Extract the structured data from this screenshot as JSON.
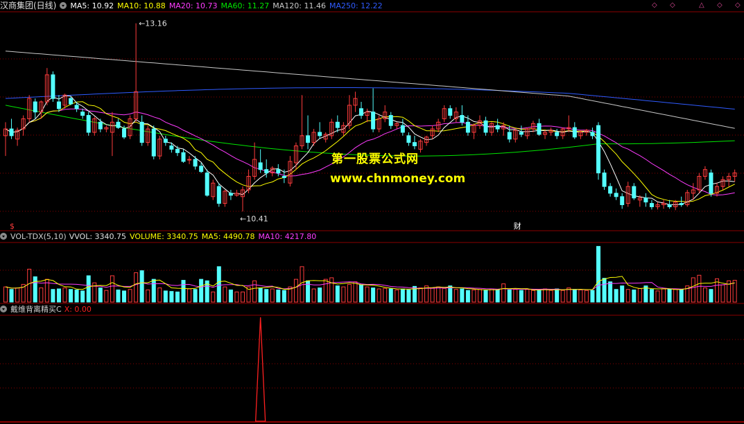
{
  "price_panel": {
    "title": "汉商集团(日线)",
    "ma": [
      {
        "label": "MA5: 10.92",
        "color": "#ffffff"
      },
      {
        "label": "MA10: 10.88",
        "color": "#ffff00"
      },
      {
        "label": "MA20: 10.73",
        "color": "#ff3cff"
      },
      {
        "label": "MA60: 11.27",
        "color": "#00e600"
      },
      {
        "label": "MA120: 11.46",
        "color": "#c8c8c8"
      },
      {
        "label": "MA250: 12.22",
        "color": "#2f5bff"
      }
    ],
    "high_label": "13.16",
    "low_label": "10.41",
    "marker_left": "$",
    "marker_fin": "财",
    "nav_icons": [
      "◇",
      "◇",
      "△",
      "◇",
      "◇"
    ]
  },
  "volume_panel": {
    "title": "VOL-TDX(5,10)",
    "vvol": "VVOL: 3340.75",
    "volume": "VOLUME: 3340.75",
    "ma5": "MA5: 4490.78",
    "ma10": "MA10: 4217.80"
  },
  "indicator_panel": {
    "title": "戴维背离精买C",
    "x_value": "X: 0.00"
  },
  "watermark": {
    "line1": "第一股票公式网",
    "line2": "www.chnmoney.com"
  },
  "colors": {
    "up": "#ff3c3c",
    "down": "#54ffff",
    "grid": "#8b0000",
    "ma5": "#ffffff",
    "ma10": "#ffff00",
    "ma20": "#ff3cff",
    "ma60": "#00e600",
    "ma120": "#c8c8c8",
    "ma250": "#2f5bff",
    "indicator": "#ff2020"
  },
  "chart_data": {
    "type": "candlestick",
    "price_axis_range": [
      10.25,
      13.3
    ],
    "candles_ohlc": [
      [
        11.5,
        11.7,
        11.2,
        11.6
      ],
      [
        11.6,
        11.75,
        11.45,
        11.5
      ],
      [
        11.45,
        11.62,
        11.35,
        11.58
      ],
      [
        11.6,
        11.8,
        11.5,
        11.75
      ],
      [
        11.75,
        12.1,
        11.7,
        12.05
      ],
      [
        12.0,
        12.05,
        11.75,
        11.85
      ],
      [
        11.85,
        12.02,
        11.75,
        12.0
      ],
      [
        12.0,
        12.5,
        11.95,
        12.4
      ],
      [
        12.4,
        12.45,
        12.0,
        12.05
      ],
      [
        12.0,
        12.1,
        11.85,
        11.9
      ],
      [
        11.95,
        12.12,
        11.9,
        12.1
      ],
      [
        12.05,
        12.08,
        11.95,
        11.97
      ],
      [
        11.95,
        12.0,
        11.85,
        11.9
      ],
      [
        11.85,
        11.9,
        11.75,
        11.8
      ],
      [
        11.8,
        11.85,
        11.5,
        11.55
      ],
      [
        11.55,
        11.78,
        11.5,
        11.75
      ],
      [
        11.7,
        11.75,
        11.55,
        11.6
      ],
      [
        11.6,
        11.65,
        11.55,
        11.62
      ],
      [
        11.55,
        11.85,
        11.2,
        11.7
      ],
      [
        11.7,
        11.75,
        11.6,
        11.62
      ],
      [
        11.6,
        11.65,
        11.45,
        11.48
      ],
      [
        11.5,
        11.8,
        11.45,
        11.75
      ],
      [
        11.75,
        13.16,
        11.7,
        12.15
      ],
      [
        11.7,
        11.8,
        11.35,
        11.4
      ],
      [
        11.4,
        11.65,
        11.35,
        11.6
      ],
      [
        11.6,
        11.65,
        11.15,
        11.2
      ],
      [
        11.2,
        11.5,
        11.15,
        11.45
      ],
      [
        11.45,
        11.5,
        11.35,
        11.4
      ],
      [
        11.35,
        11.4,
        11.25,
        11.3
      ],
      [
        11.3,
        11.35,
        11.2,
        11.25
      ],
      [
        11.25,
        11.3,
        11.1,
        11.12
      ],
      [
        11.15,
        11.2,
        11.08,
        11.15
      ],
      [
        11.15,
        11.2,
        11.0,
        11.05
      ],
      [
        11.05,
        11.1,
        10.95,
        10.97
      ],
      [
        10.95,
        11.0,
        10.6,
        10.62
      ],
      [
        10.6,
        10.85,
        10.55,
        10.8
      ],
      [
        10.75,
        10.8,
        10.45,
        10.5
      ],
      [
        10.5,
        10.7,
        10.45,
        10.68
      ],
      [
        10.65,
        10.7,
        10.55,
        10.62
      ],
      [
        10.62,
        10.7,
        10.6,
        10.65
      ],
      [
        10.6,
        10.75,
        10.38,
        10.7
      ],
      [
        10.7,
        11.0,
        10.65,
        10.9
      ],
      [
        10.9,
        11.4,
        10.85,
        11.15
      ],
      [
        11.1,
        11.3,
        10.95,
        11.0
      ],
      [
        11.0,
        11.15,
        10.88,
        10.95
      ],
      [
        10.95,
        11.05,
        10.9,
        11.02
      ],
      [
        11.0,
        11.08,
        10.9,
        10.95
      ],
      [
        10.9,
        11.0,
        10.8,
        10.88
      ],
      [
        10.8,
        11.2,
        10.75,
        11.12
      ],
      [
        11.1,
        11.4,
        11.0,
        11.35
      ],
      [
        11.35,
        12.1,
        11.3,
        11.5
      ],
      [
        11.5,
        11.8,
        11.3,
        11.4
      ],
      [
        11.4,
        11.6,
        11.35,
        11.55
      ],
      [
        11.55,
        11.7,
        11.45,
        11.5
      ],
      [
        11.45,
        11.55,
        11.4,
        11.52
      ],
      [
        11.5,
        11.75,
        11.45,
        11.7
      ],
      [
        11.7,
        11.8,
        11.55,
        11.62
      ],
      [
        11.55,
        11.7,
        11.5,
        11.65
      ],
      [
        11.65,
        12.1,
        11.6,
        11.95
      ],
      [
        11.95,
        12.15,
        11.85,
        12.05
      ],
      [
        11.9,
        12.0,
        11.75,
        11.8
      ],
      [
        11.8,
        11.9,
        11.7,
        11.85
      ],
      [
        11.85,
        12.2,
        11.55,
        11.6
      ],
      [
        11.6,
        11.8,
        11.55,
        11.75
      ],
      [
        11.75,
        11.95,
        11.7,
        11.85
      ],
      [
        11.8,
        11.85,
        11.6,
        11.65
      ],
      [
        11.65,
        11.7,
        11.6,
        11.68
      ],
      [
        11.65,
        11.75,
        11.5,
        11.55
      ],
      [
        11.5,
        11.55,
        11.35,
        11.4
      ],
      [
        11.4,
        11.5,
        11.3,
        11.35
      ],
      [
        11.3,
        11.45,
        11.25,
        11.42
      ],
      [
        11.4,
        11.5,
        11.35,
        11.48
      ],
      [
        11.5,
        11.65,
        11.45,
        11.6
      ],
      [
        11.6,
        11.75,
        11.55,
        11.7
      ],
      [
        11.75,
        11.95,
        11.7,
        11.9
      ],
      [
        11.9,
        11.95,
        11.75,
        11.8
      ],
      [
        11.75,
        11.92,
        11.7,
        11.85
      ],
      [
        11.8,
        11.95,
        11.65,
        11.7
      ],
      [
        11.7,
        11.8,
        11.5,
        11.55
      ],
      [
        11.55,
        11.68,
        11.45,
        11.65
      ],
      [
        11.65,
        11.8,
        11.6,
        11.72
      ],
      [
        11.72,
        11.78,
        11.5,
        11.55
      ],
      [
        11.55,
        11.7,
        11.5,
        11.68
      ],
      [
        11.65,
        11.75,
        11.55,
        11.6
      ],
      [
        11.6,
        11.7,
        11.5,
        11.65
      ],
      [
        11.55,
        11.65,
        11.4,
        11.45
      ],
      [
        11.45,
        11.6,
        11.4,
        11.58
      ],
      [
        11.55,
        11.65,
        11.48,
        11.52
      ],
      [
        11.5,
        11.62,
        11.45,
        11.6
      ],
      [
        11.6,
        11.72,
        11.55,
        11.68
      ],
      [
        11.68,
        11.75,
        11.5,
        11.52
      ],
      [
        11.52,
        11.58,
        11.45,
        11.55
      ],
      [
        11.55,
        11.62,
        11.5,
        11.58
      ],
      [
        11.55,
        11.6,
        11.45,
        11.5
      ],
      [
        11.5,
        11.62,
        11.45,
        11.6
      ],
      [
        11.6,
        11.8,
        11.55,
        11.62
      ],
      [
        11.62,
        11.7,
        11.45,
        11.48
      ],
      [
        11.5,
        11.58,
        11.45,
        11.55
      ],
      [
        11.55,
        11.6,
        11.5,
        11.58
      ],
      [
        11.55,
        11.62,
        11.45,
        11.5
      ],
      [
        11.65,
        11.7,
        10.85,
        10.95
      ],
      [
        10.95,
        11.0,
        10.7,
        10.75
      ],
      [
        10.75,
        10.8,
        10.6,
        10.65
      ],
      [
        10.65,
        10.72,
        10.55,
        10.6
      ],
      [
        10.6,
        10.65,
        10.42,
        10.48
      ],
      [
        10.5,
        10.82,
        10.45,
        10.75
      ],
      [
        10.75,
        10.8,
        10.55,
        10.58
      ],
      [
        10.55,
        10.62,
        10.45,
        10.58
      ],
      [
        10.58,
        10.65,
        10.45,
        10.52
      ],
      [
        10.5,
        10.55,
        10.41,
        10.45
      ],
      [
        10.45,
        10.52,
        10.41,
        10.48
      ],
      [
        10.48,
        10.55,
        10.42,
        10.5
      ],
      [
        10.48,
        10.55,
        10.42,
        10.45
      ],
      [
        10.45,
        10.55,
        10.4,
        10.52
      ],
      [
        10.5,
        10.6,
        10.45,
        10.48
      ],
      [
        10.48,
        10.7,
        10.45,
        10.66
      ],
      [
        10.65,
        10.8,
        10.55,
        10.7
      ],
      [
        10.7,
        10.95,
        10.65,
        10.9
      ],
      [
        10.9,
        11.05,
        10.85,
        11.0
      ],
      [
        10.95,
        11.0,
        10.6,
        10.65
      ],
      [
        10.65,
        10.8,
        10.6,
        10.75
      ],
      [
        10.75,
        10.9,
        10.7,
        10.85
      ],
      [
        10.85,
        10.95,
        10.75,
        10.9
      ],
      [
        10.9,
        11.0,
        10.82,
        10.95
      ]
    ],
    "volumes": [
      3,
      2.5,
      2.8,
      3.5,
      6.5,
      5,
      2.8,
      4.5,
      2.5,
      2.6,
      2.8,
      2.5,
      2.4,
      2.2,
      5.2,
      3.8,
      2.8,
      2.3,
      5.2,
      2.4,
      2.2,
      2.5,
      5.8,
      6.2,
      2.4,
      4.5,
      2.8,
      2.2,
      2.1,
      2,
      4.3,
      2.6,
      2.5,
      4.5,
      4.2,
      2,
      7,
      3,
      2.4,
      2,
      2,
      3,
      4.2,
      2.8,
      2.5,
      2.6,
      2.4,
      2.3,
      3,
      4.5,
      7,
      4.2,
      2.6,
      2.8,
      4.5,
      4.8,
      3.2,
      3,
      3.5,
      4,
      3.4,
      3,
      2.8,
      2.6,
      2.7,
      2.6,
      2.4,
      2.6,
      2.4,
      3.1,
      2.8,
      3.2,
      2.8,
      3,
      2.7,
      3.2,
      2.5,
      2.6,
      2.3,
      2.4,
      2.5,
      2.3,
      2.6,
      2.4,
      3.6,
      2.4,
      2.5,
      2.3,
      2.5,
      2.3,
      2.4,
      2.6,
      2.3,
      2.6,
      2.3,
      2.8,
      2.5,
      2.4,
      2.3,
      2.3,
      11,
      4.7,
      4,
      2.5,
      3.2,
      2.5,
      2.4,
      2.7,
      3.2,
      2.5,
      2.2,
      2.6,
      2.6,
      2.5,
      2.5,
      3.2,
      4.8,
      5.3,
      2.8,
      2.5,
      4.6,
      3.4,
      4.2,
      4.3
    ],
    "indicator_spike_index": 43
  }
}
